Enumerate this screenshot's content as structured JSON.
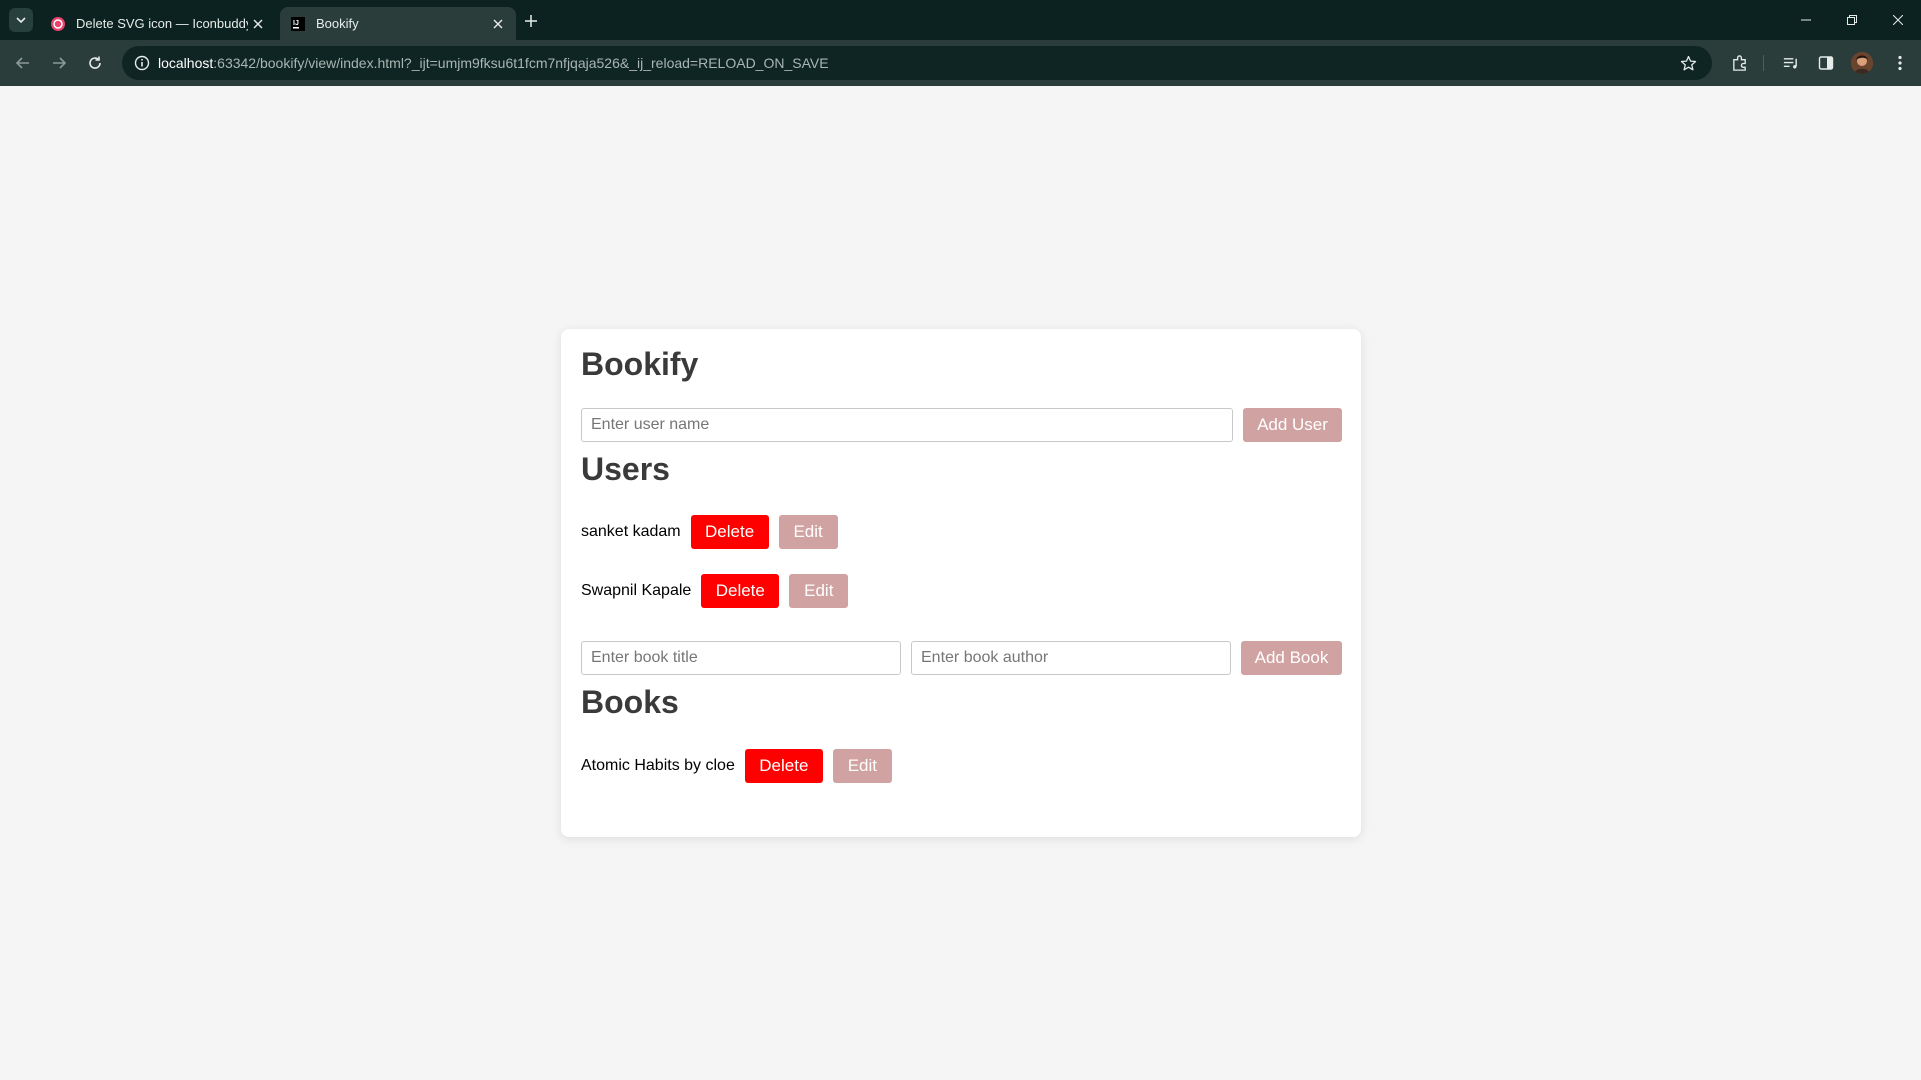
{
  "browser": {
    "tabs": [
      {
        "title": "Delete SVG icon — Iconbuddy",
        "active": false,
        "favicon": "iconbuddy-favicon"
      },
      {
        "title": "Bookify",
        "active": true,
        "favicon": "jetbrains-favicon"
      }
    ],
    "url_host": "localhost",
    "url_rest": ":63342/bookify/view/index.html?_ijt=umjm9fksu6t1fcm7nfjqaja526&_ij_reload=RELOAD_ON_SAVE"
  },
  "app": {
    "title": "Bookify",
    "user_input_placeholder": "Enter user name",
    "add_user_label": "Add User",
    "users_heading": "Users",
    "users": [
      {
        "name": "sanket kadam",
        "delete_label": "Delete",
        "edit_label": "Edit"
      },
      {
        "name": "Swapnil Kapale",
        "delete_label": "Delete",
        "edit_label": "Edit"
      }
    ],
    "book_title_placeholder": "Enter book title",
    "book_author_placeholder": "Enter book author",
    "add_book_label": "Add Book",
    "books_heading": "Books",
    "books": [
      {
        "label": "Atomic Habits by cloe",
        "delete_label": "Delete",
        "edit_label": "Edit"
      }
    ]
  },
  "colors": {
    "chrome_dark": "#0c2220",
    "chrome_toolbar": "#2a3d3b",
    "page_bg": "#f5f5f5",
    "delete_button": "#ff0000",
    "secondary_button": "#d1a2a2"
  }
}
